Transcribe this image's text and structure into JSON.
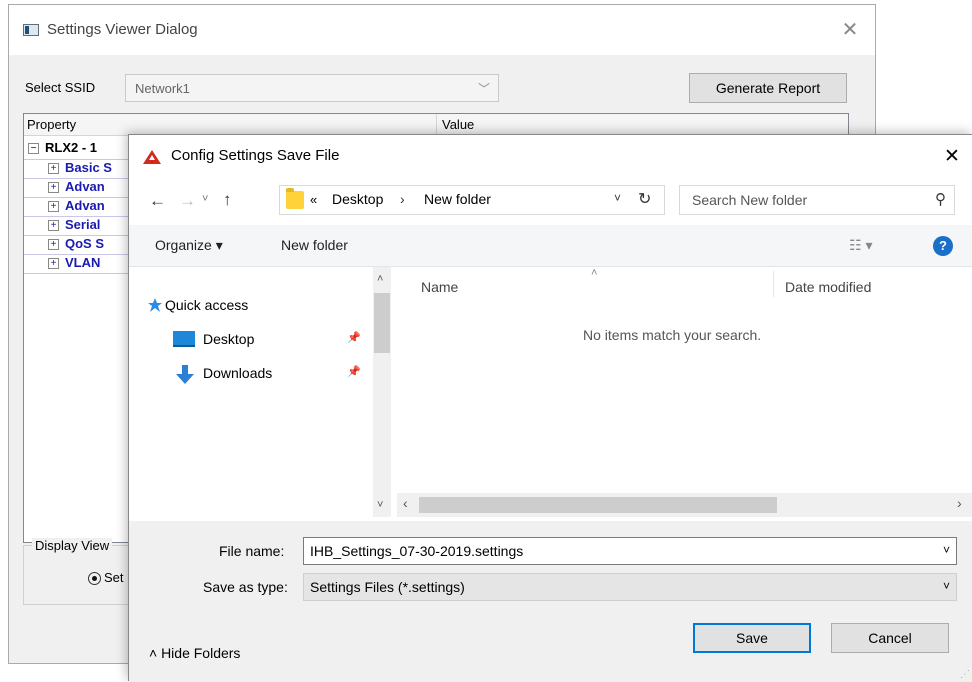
{
  "back_dialog": {
    "title": "Settings Viewer Dialog",
    "close_glyph": "✕",
    "ssid_label": "Select SSID",
    "ssid_value": "Network1",
    "ssid_chevron": "﹀",
    "generate_button": "Generate Report",
    "tree": {
      "col_property": "Property",
      "col_value": "Value",
      "root": {
        "expander": "−",
        "label": "RLX2  - 1"
      },
      "children": [
        {
          "expander": "+",
          "label": "Basic S"
        },
        {
          "expander": "+",
          "label": "Advan"
        },
        {
          "expander": "+",
          "label": "Advan"
        },
        {
          "expander": "+",
          "label": "Serial"
        },
        {
          "expander": "+",
          "label": "QoS S"
        },
        {
          "expander": "+",
          "label": "VLAN"
        }
      ]
    },
    "display_view": {
      "label": "Display View",
      "radio_label": "Set"
    }
  },
  "front_dialog": {
    "title": "Config Settings Save File",
    "close_glyph": "✕",
    "nav": {
      "back": "←",
      "forward": "→",
      "recent": "˅",
      "up": "↑"
    },
    "address": {
      "more": "«",
      "crumb1": "Desktop",
      "separator": "›",
      "crumb2": "New folder",
      "chevron": "˅",
      "refresh": "↻"
    },
    "search": {
      "placeholder": "Search New folder",
      "icon": "⚲"
    },
    "toolbar": {
      "organize": "Organize ▾",
      "new_folder": "New folder",
      "view": "☷ ▾",
      "help": "?"
    },
    "nav_pane": {
      "quick_access": "Quick access",
      "desktop": "Desktop",
      "downloads": "Downloads",
      "pin_glyph": "📌",
      "scroll_up": "˄",
      "scroll_down": "˅"
    },
    "file_pane": {
      "sort_caret": "˄",
      "col_name": "Name",
      "col_date": "Date modified",
      "empty_message": "No items match your search.",
      "scroll_left": "‹",
      "scroll_right": "›"
    },
    "bottom": {
      "filename_label": "File name:",
      "filename_value": "IHB_Settings_07-30-2019.settings",
      "saveas_label": "Save as type:",
      "saveas_value": "Settings Files (*.settings)",
      "chevron": "˅",
      "hide_folders": "˄  Hide Folders",
      "save": "Save",
      "cancel": "Cancel"
    }
  },
  "colors": {
    "accent": "#0078d7",
    "tree_child": "#1a1ab0",
    "help_icon": "#1a6fc9",
    "folder": "#ffd23a",
    "app_logo": "#d42a1e"
  }
}
